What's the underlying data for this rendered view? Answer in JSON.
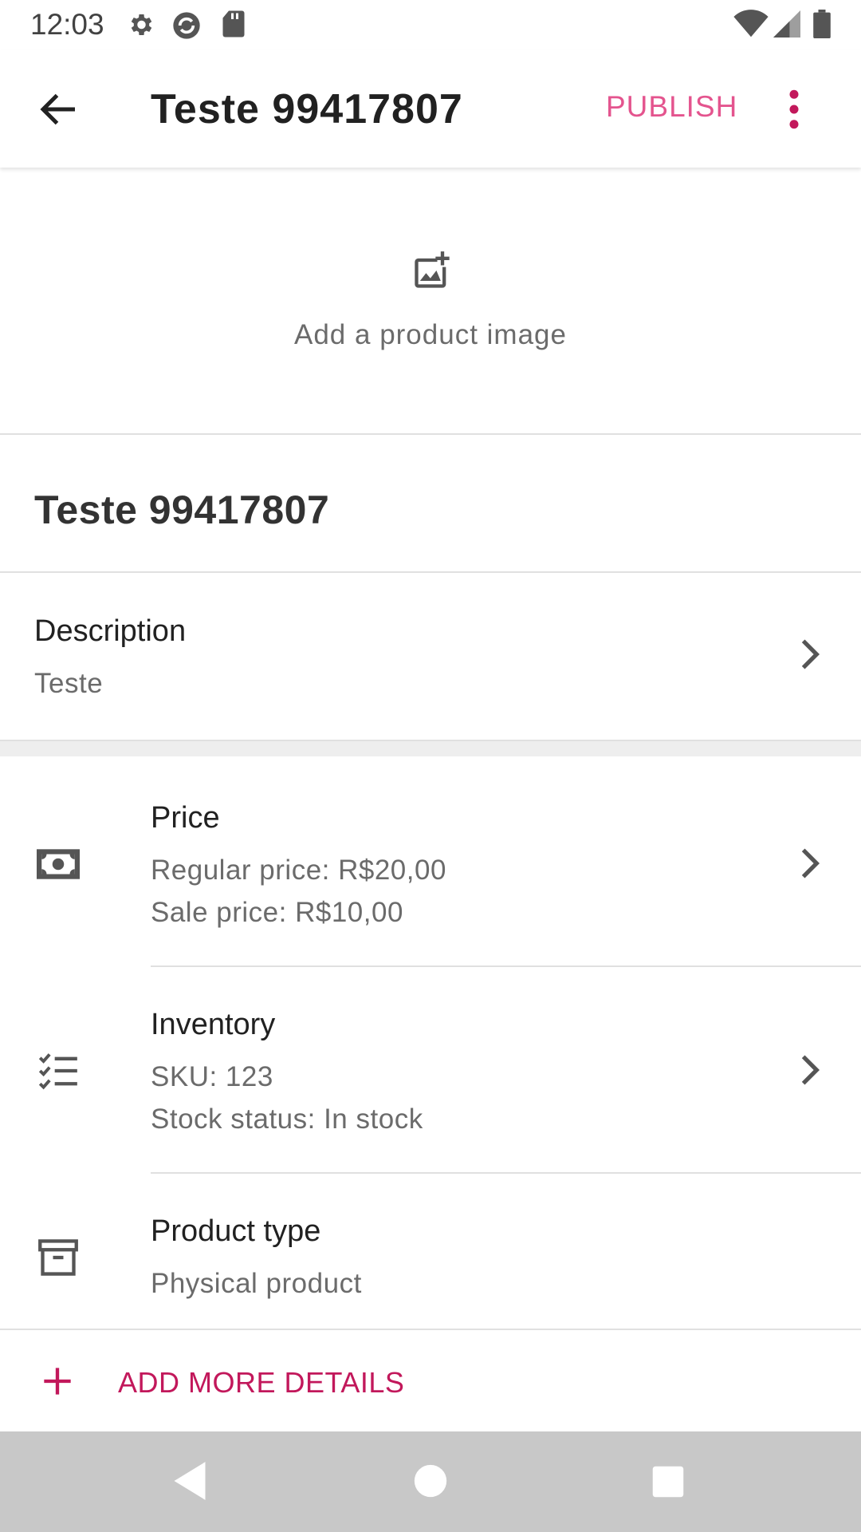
{
  "status_bar": {
    "time": "12:03",
    "icons": [
      "settings-icon",
      "sync-icon",
      "sd-card-icon",
      "wifi-icon",
      "signal-icon",
      "battery-icon"
    ]
  },
  "app_bar": {
    "title": "Teste 99417807",
    "publish_label": "PUBLISH",
    "accent_color": "#e4548e"
  },
  "image_section": {
    "label": "Add a product image"
  },
  "product": {
    "name": "Teste 99417807"
  },
  "description": {
    "title": "Description",
    "value": "Teste"
  },
  "price": {
    "title": "Price",
    "regular": "Regular price: R$20,00",
    "sale": "Sale price: R$10,00"
  },
  "inventory": {
    "title": "Inventory",
    "sku": "SKU: 123",
    "stock": "Stock status: In stock"
  },
  "product_type": {
    "title": "Product type",
    "value": "Physical product"
  },
  "add_more": {
    "label": "ADD MORE DETAILS",
    "color": "#c2185b"
  }
}
